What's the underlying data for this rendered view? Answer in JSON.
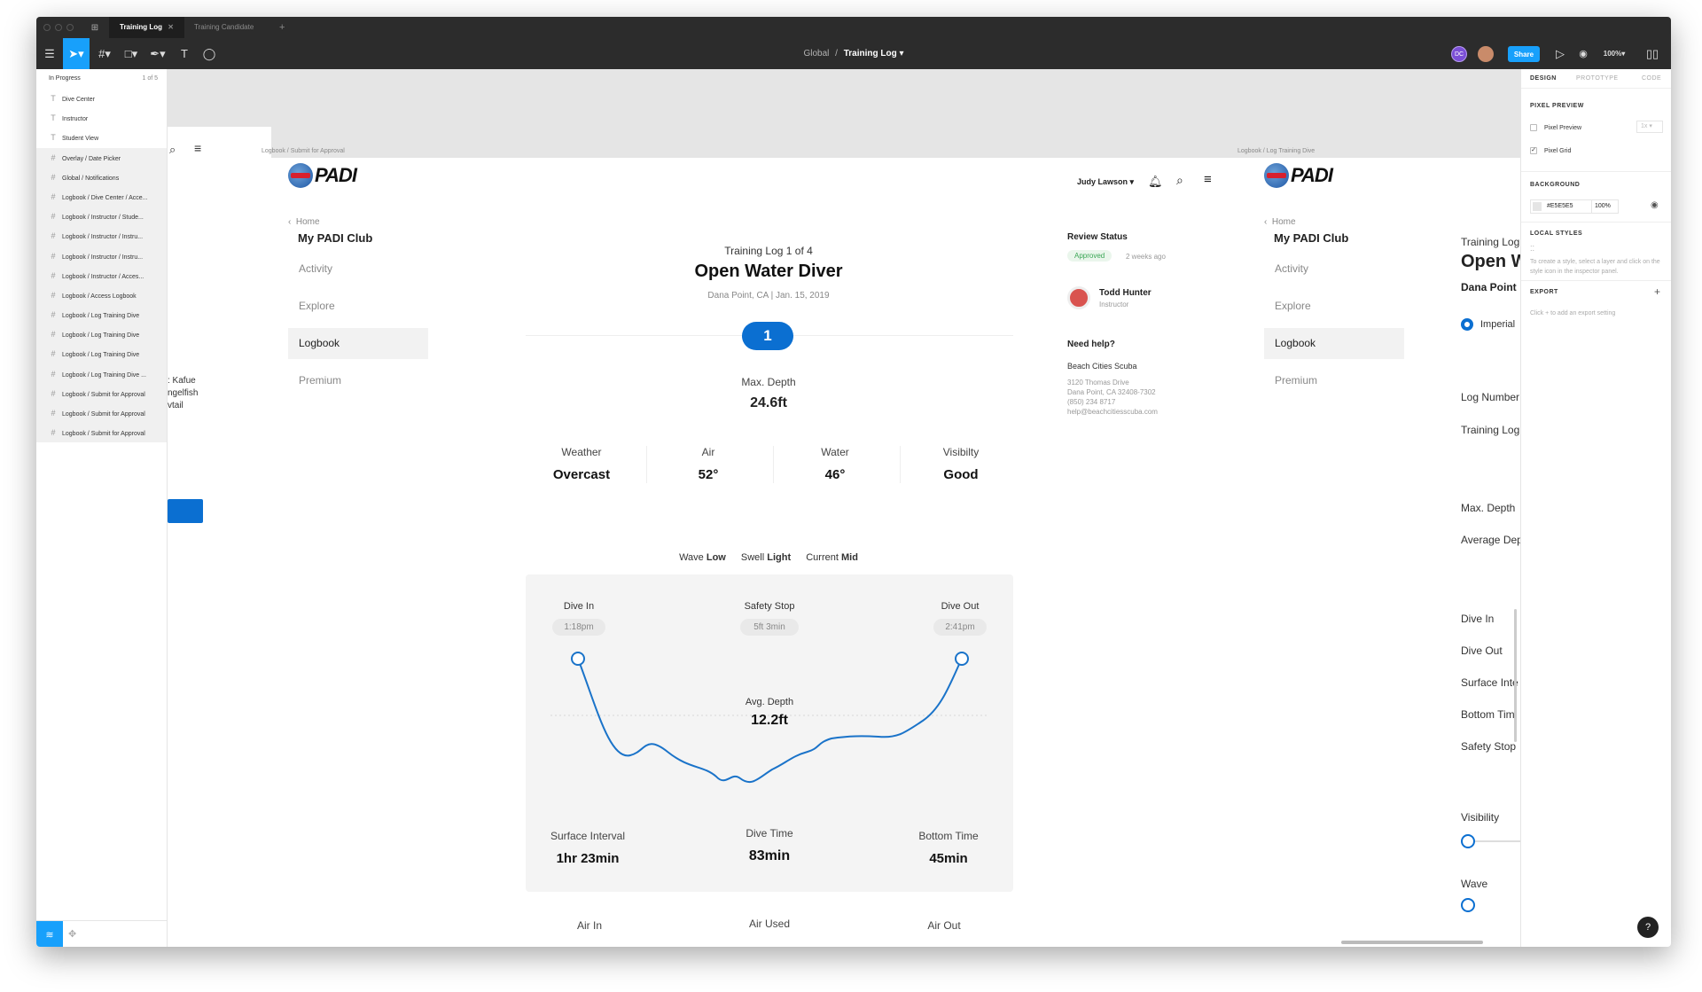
{
  "tabs": {
    "active": "Training Log",
    "other": "Training Candidate",
    "add": "+"
  },
  "toolbar": {
    "breadcrumb_parent": "Global",
    "breadcrumb_sep": "/",
    "breadcrumb_current": "Training Log",
    "avatar_initials": "DC",
    "share_label": "Share",
    "zoom": "100%"
  },
  "layers": {
    "header": "In Progress",
    "count": "1 of 5",
    "items": [
      {
        "label": "Dive Center",
        "kind": "text"
      },
      {
        "label": "Instructor",
        "kind": "text"
      },
      {
        "label": "Student View",
        "kind": "text"
      },
      {
        "label": "Overlay / Date Picker",
        "kind": "frame"
      },
      {
        "label": "Global / Notifications",
        "kind": "frame"
      },
      {
        "label": "Logbook / Dive Center / Acce...",
        "kind": "frame"
      },
      {
        "label": "Logbook / Instructor / Stude...",
        "kind": "frame"
      },
      {
        "label": "Logbook / Instructor / Instru...",
        "kind": "frame"
      },
      {
        "label": "Logbook / Instructor / Instru...",
        "kind": "frame"
      },
      {
        "label": "Logbook / Instructor / Acces...",
        "kind": "frame"
      },
      {
        "label": "Logbook / Access Logbook",
        "kind": "frame"
      },
      {
        "label": "Logbook / Log Training Dive",
        "kind": "frame"
      },
      {
        "label": "Logbook / Log Training Dive",
        "kind": "frame"
      },
      {
        "label": "Logbook / Log Training Dive",
        "kind": "frame"
      },
      {
        "label": "Logbook / Log Training Dive ...",
        "kind": "frame"
      },
      {
        "label": "Logbook / Submit for Approval",
        "kind": "frame"
      },
      {
        "label": "Logbook / Submit for Approval",
        "kind": "frame"
      },
      {
        "label": "Logbook / Submit for Approval",
        "kind": "frame"
      }
    ]
  },
  "canvas": {
    "left_partial_texts": [
      ": Kafue",
      "ngelfish",
      "vtail"
    ],
    "frame_label_1": "Logbook / Submit for Approval",
    "frame_label_2": "Logbook / Log Training Dive"
  },
  "nav": {
    "logo_text": "PADI",
    "back": "Home",
    "title": "My PADI Club",
    "items": [
      "Activity",
      "Explore",
      "Logbook",
      "Premium"
    ],
    "selected_index": 2
  },
  "header": {
    "user": "Judy Lawson"
  },
  "log": {
    "subtitle": "Training Log 1 of 4",
    "title": "Open Water Diver",
    "location": "Dana Point, CA | Jan. 15, 2019",
    "dive_number": "1",
    "max_depth_label": "Max. Depth",
    "max_depth": "24.6ft",
    "conditions": [
      {
        "label": "Weather",
        "value": "Overcast"
      },
      {
        "label": "Air",
        "value": "52°"
      },
      {
        "label": "Water",
        "value": "46°"
      },
      {
        "label": "Visibilty",
        "value": "Good"
      }
    ],
    "wave_label": "Wave",
    "wave": "Low",
    "swell_label": "Swell",
    "swell": "Light",
    "current_label": "Current",
    "current": "Mid"
  },
  "profile": {
    "dive_in_label": "Dive In",
    "dive_in": "1:18pm",
    "safety_label": "Safety Stop",
    "safety": "5ft 3min",
    "dive_out_label": "Dive Out",
    "dive_out": "2:41pm",
    "avg_label": "Avg. Depth",
    "avg": "12.2ft",
    "surface_label": "Surface Interval",
    "surface": "1hr 23min",
    "divetime_label": "Dive Time",
    "divetime": "83min",
    "bottom_label": "Bottom Time",
    "bottom": "45min",
    "air_in_label": "Air In",
    "air_used_label": "Air Used",
    "air_out_label": "Air Out",
    "line_color": "#1a73c9"
  },
  "review": {
    "title": "Review Status",
    "status": "Approved",
    "when": "2 weeks ago",
    "person": "Todd Hunter",
    "role": "Instructor",
    "help_title": "Need help?",
    "center_name": "Beach Cities Scuba",
    "address1": "3120 Thomas Drive",
    "address2": "Dana Point, CA 32408-7302",
    "phone": "(850) 234 8717",
    "email": "help@beachcitiesscuba.com"
  },
  "right_frame": {
    "subtitle": "Training Log",
    "title": "Open W",
    "location": "Dana Point",
    "radio": "Imperial",
    "fields": [
      "Log Number",
      "Training Log",
      "Max. Depth",
      "Average Dep",
      "Dive In",
      "Dive Out",
      "Surface Inte",
      "Bottom Tim",
      "Safety Stop",
      "Visibility",
      "Wave"
    ]
  },
  "props": {
    "tabs": [
      "DESIGN",
      "PROTOTYPE",
      "CODE"
    ],
    "pixel_preview_section": "PIXEL PREVIEW",
    "pixel_preview": "Pixel Preview",
    "pixel_preview_scale": "1x",
    "pixel_grid": "Pixel Grid",
    "background_section": "BACKGROUND",
    "bg_hex": "#E5E5E5",
    "bg_opacity": "100%",
    "local_styles_section": "LOCAL STYLES",
    "local_styles_hint": "To create a style, select a layer and click on the style icon in the inspector panel.",
    "export_section": "EXPORT",
    "export_hint": "Click + to add an export setting",
    "help": "?"
  },
  "colors": {
    "accent": "#18a0fb",
    "brand_blue": "#0b6fd1",
    "approved_green": "#3aa655"
  }
}
